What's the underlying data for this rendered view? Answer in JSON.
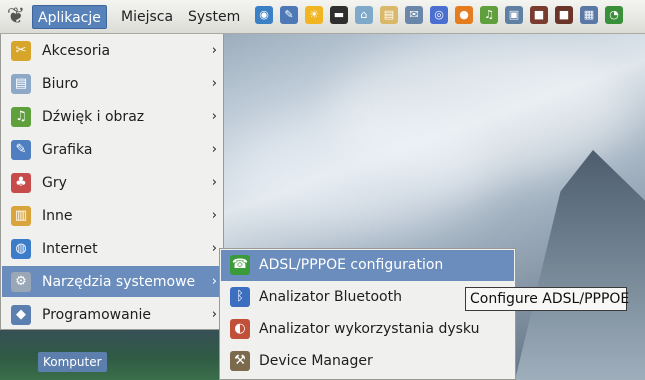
{
  "panel": {
    "menus": [
      "Aplikacje",
      "Miejsca",
      "System"
    ],
    "launchers": [
      {
        "icon": "globe-browser-icon",
        "color": "#3b7fc4",
        "glyph": "◉"
      },
      {
        "icon": "text-editor-icon",
        "color": "#4f79b6",
        "glyph": "✎"
      },
      {
        "icon": "sun-weather-icon",
        "color": "#f0b521",
        "glyph": "☀"
      },
      {
        "icon": "terminal-icon",
        "color": "#2f2f2f",
        "glyph": "▬"
      },
      {
        "icon": "network-icon",
        "color": "#7ea9c9",
        "glyph": "⌂"
      },
      {
        "icon": "notes-icon",
        "color": "#d9b86a",
        "glyph": "▤"
      },
      {
        "icon": "mail-icon",
        "color": "#6a86a8",
        "glyph": "✉"
      },
      {
        "icon": "wireless-icon",
        "color": "#4a6fd1",
        "glyph": "◎"
      },
      {
        "icon": "firefox-icon",
        "color": "#e57c1f",
        "glyph": "●"
      },
      {
        "icon": "music-player-icon",
        "color": "#5f9f3c",
        "glyph": "♫"
      },
      {
        "icon": "photo-icon",
        "color": "#5f7fa3",
        "glyph": "▣"
      },
      {
        "icon": "archive-icon",
        "color": "#7a3c2f",
        "glyph": "■"
      },
      {
        "icon": "package-icon",
        "color": "#6a3528",
        "glyph": "■"
      },
      {
        "icon": "calculator-icon",
        "color": "#5a78a6",
        "glyph": "▦"
      },
      {
        "icon": "update-icon",
        "color": "#3a8f3a",
        "glyph": "◔"
      }
    ]
  },
  "menu": {
    "items": [
      {
        "label": "Akcesoria",
        "icon": "accessories-icon",
        "color": "#d8a52b",
        "glyph": "✂",
        "arrow": "›"
      },
      {
        "label": "Biuro",
        "icon": "office-icon",
        "color": "#8ea9c8",
        "glyph": "▤",
        "arrow": "›"
      },
      {
        "label": "Dźwięk i obraz",
        "icon": "multimedia-icon",
        "color": "#5f9f3c",
        "glyph": "♫",
        "arrow": "›"
      },
      {
        "label": "Grafika",
        "icon": "graphics-icon",
        "color": "#4f7fc0",
        "glyph": "✎",
        "arrow": "›"
      },
      {
        "label": "Gry",
        "icon": "games-icon",
        "color": "#c84b4b",
        "glyph": "♣",
        "arrow": "›"
      },
      {
        "label": "Inne",
        "icon": "other-icon",
        "color": "#d9a43b",
        "glyph": "▥",
        "arrow": "›"
      },
      {
        "label": "Internet",
        "icon": "internet-icon",
        "color": "#3d7cc8",
        "glyph": "◍",
        "arrow": "›"
      },
      {
        "label": "Narzędzia systemowe",
        "icon": "system-tools-icon",
        "color": "#9aa7b6",
        "glyph": "⚙",
        "arrow": "›"
      },
      {
        "label": "Programowanie",
        "icon": "programming-icon",
        "color": "#5b7fb0",
        "glyph": "◆",
        "arrow": "›"
      }
    ]
  },
  "submenu": {
    "items": [
      {
        "label": "ADSL/PPPOE configuration",
        "icon": "adsl-config-icon",
        "color": "#3b9b3b",
        "glyph": "☎"
      },
      {
        "label": "Analizator Bluetooth",
        "icon": "bluetooth-icon",
        "color": "#3c6fc0",
        "glyph": "ᛒ"
      },
      {
        "label": "Analizator wykorzystania dysku",
        "icon": "disk-usage-icon",
        "color": "#c0503a",
        "glyph": "◐"
      },
      {
        "label": "Device Manager",
        "icon": "device-manager-icon",
        "color": "#7b6a4c",
        "glyph": "⚒"
      }
    ]
  },
  "tooltip": {
    "text": "Configure ADSL/PPPOE"
  },
  "desktop": {
    "computer_label": "Komputer"
  }
}
